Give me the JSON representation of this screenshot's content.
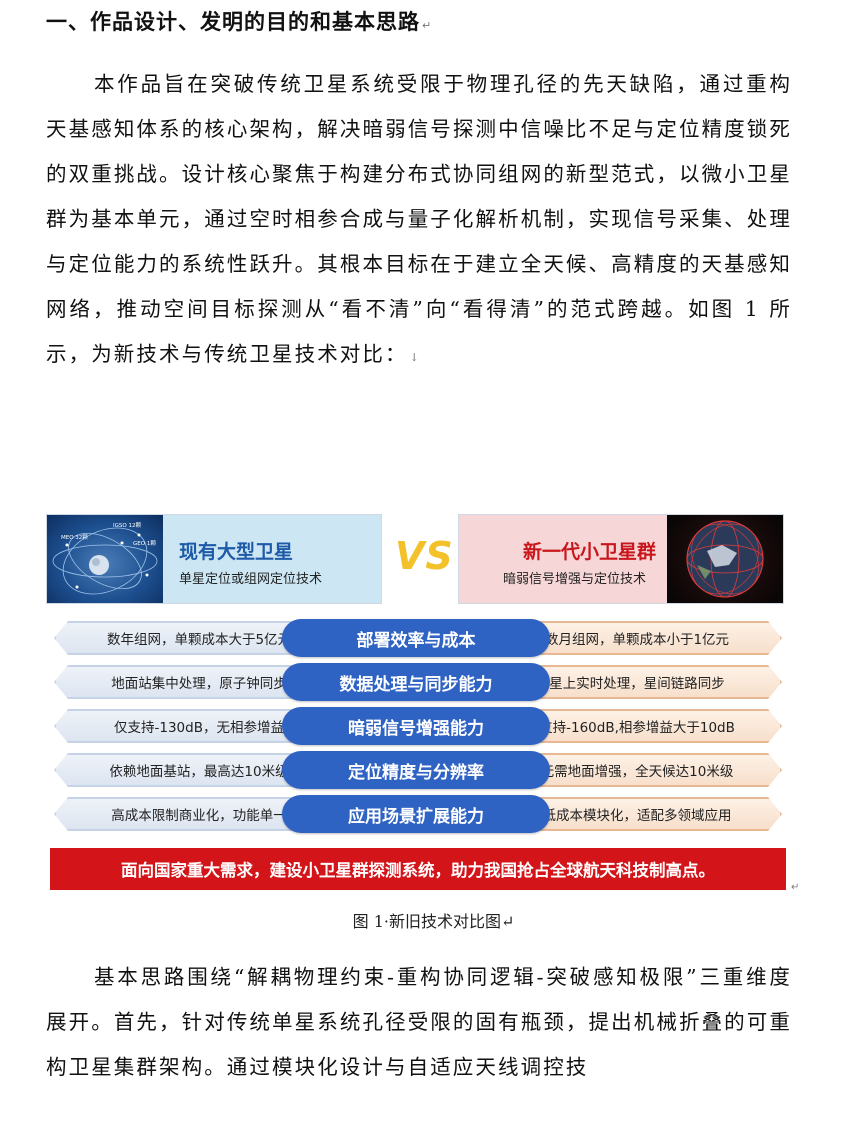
{
  "section_heading": "一、作品设计、发明的目的和基本思路",
  "para_mark": "↵",
  "paragraph1": "本作品旨在突破传统卫星系统受限于物理孔径的先天缺陷，通过重构天基感知体系的核心架构，解决暗弱信号探测中信噪比不足与定位精度锁死的双重挑战。设计核心聚焦于构建分布式协同组网的新型范式，以微小卫星群为基本单元，通过空时相参合成与量子化解析机制，实现信号采集、处理与定位能力的系统性跃升。其根本目标在于建立全天候、高精度的天基感知网络，推动空间目标探测从“看不清”向“看得清”的范式跨越。如图 1 所示，为新技术与传统卫星技术对比：",
  "paragraph1_mark": "↓",
  "figure": {
    "left_card": {
      "title": "现有大型卫星",
      "subtitle": "单星定位或组网定位技术",
      "orbit_labels": [
        "IGSO 12颗",
        "MEO 32颗",
        "GEO 1颗"
      ]
    },
    "vs_label": "VS",
    "right_card": {
      "title": "新一代小卫星群",
      "subtitle": "暗弱信号增强与定位技术"
    },
    "rows": [
      {
        "left": "数年组网，单颗成本大于5亿元",
        "center": "部署效率与成本",
        "right": "数月组网，单颗成本小于1亿元"
      },
      {
        "left": "地面站集中处理，原子钟同步",
        "center": "数据处理与同步能力",
        "right": "星上实时处理，星间链路同步"
      },
      {
        "left": "仅支持-130dB，无相参增益",
        "center": "暗弱信号增强能力",
        "right": "支持-160dB,相参增益大于10dB"
      },
      {
        "left": "依赖地面基站，最高达10米级",
        "center": "定位精度与分辨率",
        "right": "无需地面增强，全天候达10米级"
      },
      {
        "left": "高成本限制商业化，功能单一",
        "center": "应用场景扩展能力",
        "right": "低成本模块化，适配多领域应用"
      }
    ],
    "banner": "面向国家重大需求，建设小卫星群探测系统，助力我国抢占全球航天科技制高点。",
    "enter_mark": "↵"
  },
  "caption": "图 1·新旧技术对比图↵",
  "paragraph2": "基本思路围绕“解耦物理约束-重构协同逻辑-突破感知极限”三重维度展开。首先，针对传统单星系统孔径受限的固有瓶颈，提出机械折叠的可重构卫星集群架构。通过模块化设计与自适应天线调控技"
}
